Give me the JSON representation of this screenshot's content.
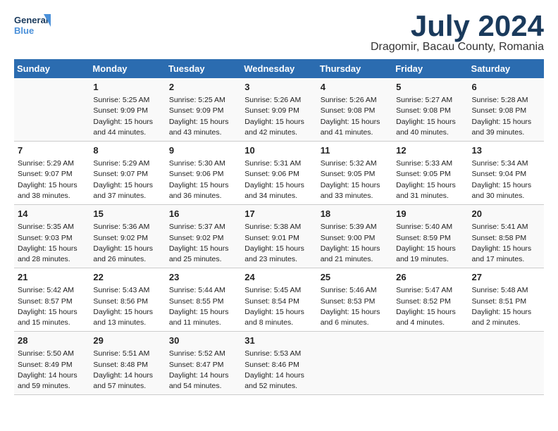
{
  "logo": {
    "line1": "General",
    "line2": "Blue"
  },
  "title": "July 2024",
  "subtitle": "Dragomir, Bacau County, Romania",
  "headers": [
    "Sunday",
    "Monday",
    "Tuesday",
    "Wednesday",
    "Thursday",
    "Friday",
    "Saturday"
  ],
  "weeks": [
    [
      {
        "day": "",
        "info": ""
      },
      {
        "day": "1",
        "info": "Sunrise: 5:25 AM\nSunset: 9:09 PM\nDaylight: 15 hours\nand 44 minutes."
      },
      {
        "day": "2",
        "info": "Sunrise: 5:25 AM\nSunset: 9:09 PM\nDaylight: 15 hours\nand 43 minutes."
      },
      {
        "day": "3",
        "info": "Sunrise: 5:26 AM\nSunset: 9:09 PM\nDaylight: 15 hours\nand 42 minutes."
      },
      {
        "day": "4",
        "info": "Sunrise: 5:26 AM\nSunset: 9:08 PM\nDaylight: 15 hours\nand 41 minutes."
      },
      {
        "day": "5",
        "info": "Sunrise: 5:27 AM\nSunset: 9:08 PM\nDaylight: 15 hours\nand 40 minutes."
      },
      {
        "day": "6",
        "info": "Sunrise: 5:28 AM\nSunset: 9:08 PM\nDaylight: 15 hours\nand 39 minutes."
      }
    ],
    [
      {
        "day": "7",
        "info": "Sunrise: 5:29 AM\nSunset: 9:07 PM\nDaylight: 15 hours\nand 38 minutes."
      },
      {
        "day": "8",
        "info": "Sunrise: 5:29 AM\nSunset: 9:07 PM\nDaylight: 15 hours\nand 37 minutes."
      },
      {
        "day": "9",
        "info": "Sunrise: 5:30 AM\nSunset: 9:06 PM\nDaylight: 15 hours\nand 36 minutes."
      },
      {
        "day": "10",
        "info": "Sunrise: 5:31 AM\nSunset: 9:06 PM\nDaylight: 15 hours\nand 34 minutes."
      },
      {
        "day": "11",
        "info": "Sunrise: 5:32 AM\nSunset: 9:05 PM\nDaylight: 15 hours\nand 33 minutes."
      },
      {
        "day": "12",
        "info": "Sunrise: 5:33 AM\nSunset: 9:05 PM\nDaylight: 15 hours\nand 31 minutes."
      },
      {
        "day": "13",
        "info": "Sunrise: 5:34 AM\nSunset: 9:04 PM\nDaylight: 15 hours\nand 30 minutes."
      }
    ],
    [
      {
        "day": "14",
        "info": "Sunrise: 5:35 AM\nSunset: 9:03 PM\nDaylight: 15 hours\nand 28 minutes."
      },
      {
        "day": "15",
        "info": "Sunrise: 5:36 AM\nSunset: 9:02 PM\nDaylight: 15 hours\nand 26 minutes."
      },
      {
        "day": "16",
        "info": "Sunrise: 5:37 AM\nSunset: 9:02 PM\nDaylight: 15 hours\nand 25 minutes."
      },
      {
        "day": "17",
        "info": "Sunrise: 5:38 AM\nSunset: 9:01 PM\nDaylight: 15 hours\nand 23 minutes."
      },
      {
        "day": "18",
        "info": "Sunrise: 5:39 AM\nSunset: 9:00 PM\nDaylight: 15 hours\nand 21 minutes."
      },
      {
        "day": "19",
        "info": "Sunrise: 5:40 AM\nSunset: 8:59 PM\nDaylight: 15 hours\nand 19 minutes."
      },
      {
        "day": "20",
        "info": "Sunrise: 5:41 AM\nSunset: 8:58 PM\nDaylight: 15 hours\nand 17 minutes."
      }
    ],
    [
      {
        "day": "21",
        "info": "Sunrise: 5:42 AM\nSunset: 8:57 PM\nDaylight: 15 hours\nand 15 minutes."
      },
      {
        "day": "22",
        "info": "Sunrise: 5:43 AM\nSunset: 8:56 PM\nDaylight: 15 hours\nand 13 minutes."
      },
      {
        "day": "23",
        "info": "Sunrise: 5:44 AM\nSunset: 8:55 PM\nDaylight: 15 hours\nand 11 minutes."
      },
      {
        "day": "24",
        "info": "Sunrise: 5:45 AM\nSunset: 8:54 PM\nDaylight: 15 hours\nand 8 minutes."
      },
      {
        "day": "25",
        "info": "Sunrise: 5:46 AM\nSunset: 8:53 PM\nDaylight: 15 hours\nand 6 minutes."
      },
      {
        "day": "26",
        "info": "Sunrise: 5:47 AM\nSunset: 8:52 PM\nDaylight: 15 hours\nand 4 minutes."
      },
      {
        "day": "27",
        "info": "Sunrise: 5:48 AM\nSunset: 8:51 PM\nDaylight: 15 hours\nand 2 minutes."
      }
    ],
    [
      {
        "day": "28",
        "info": "Sunrise: 5:50 AM\nSunset: 8:49 PM\nDaylight: 14 hours\nand 59 minutes."
      },
      {
        "day": "29",
        "info": "Sunrise: 5:51 AM\nSunset: 8:48 PM\nDaylight: 14 hours\nand 57 minutes."
      },
      {
        "day": "30",
        "info": "Sunrise: 5:52 AM\nSunset: 8:47 PM\nDaylight: 14 hours\nand 54 minutes."
      },
      {
        "day": "31",
        "info": "Sunrise: 5:53 AM\nSunset: 8:46 PM\nDaylight: 14 hours\nand 52 minutes."
      },
      {
        "day": "",
        "info": ""
      },
      {
        "day": "",
        "info": ""
      },
      {
        "day": "",
        "info": ""
      }
    ]
  ]
}
